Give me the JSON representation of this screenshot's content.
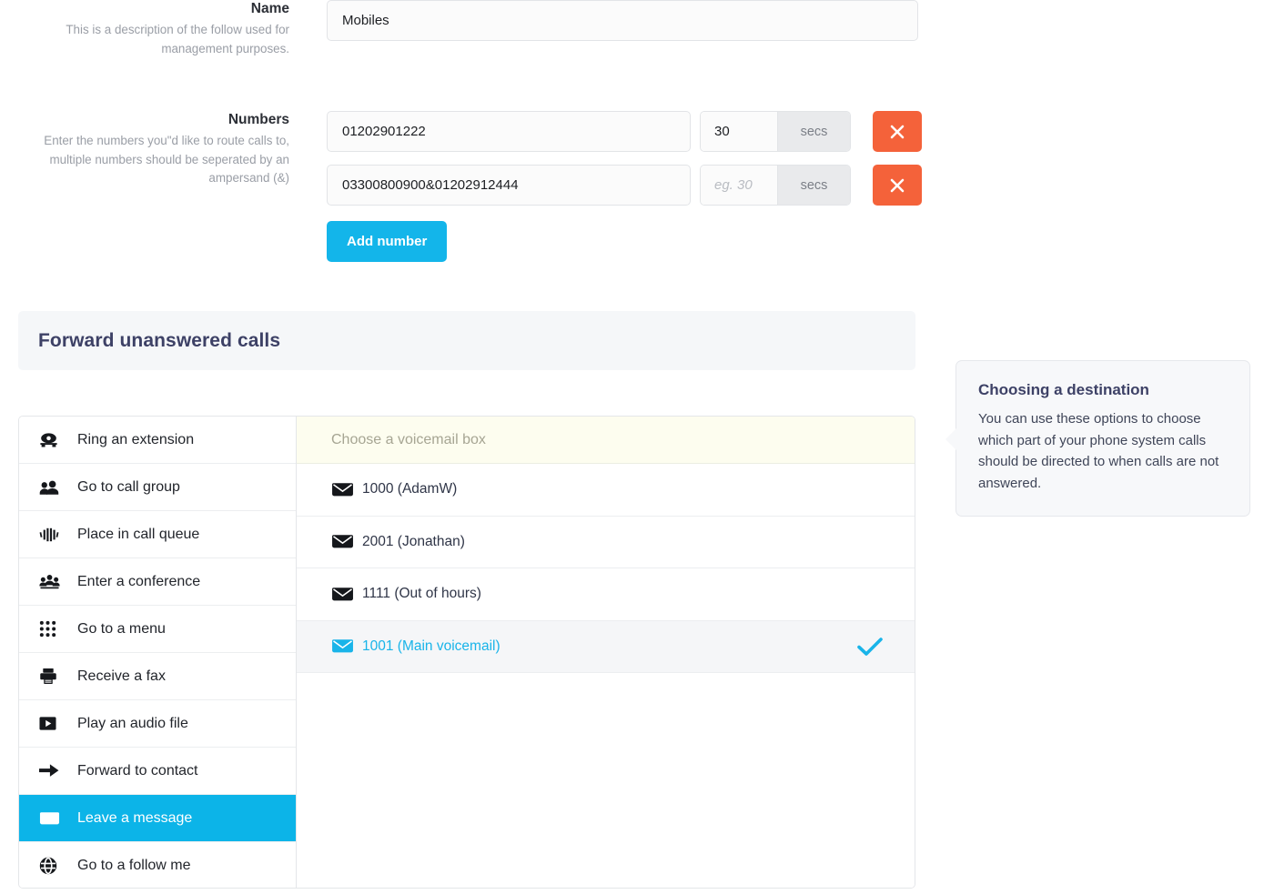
{
  "form": {
    "name_field": {
      "label": "Name",
      "help": "This is a description of the follow used for management purposes.",
      "value": "Mobiles"
    },
    "numbers_field": {
      "label": "Numbers",
      "help": "Enter the numbers you\"d like to route calls to, multiple numbers should be seperated by an ampersand (&)",
      "rows": [
        {
          "number": "01202901222",
          "secs_value": "30",
          "secs_placeholder": "eg. 30",
          "secs_unit": "secs",
          "remove_label": "×"
        },
        {
          "number": "03300800900&01202912444",
          "secs_value": "",
          "secs_placeholder": "eg. 30",
          "secs_unit": "secs",
          "remove_label": "×"
        }
      ],
      "add_button": "Add number"
    }
  },
  "section": {
    "title": "Forward unanswered calls"
  },
  "destinations": [
    {
      "label": "Ring an extension",
      "icon": "telephone-icon",
      "active": false
    },
    {
      "label": "Go to call group",
      "icon": "users-icon",
      "active": false
    },
    {
      "label": "Place in call queue",
      "icon": "signal-bars-icon",
      "active": false
    },
    {
      "label": "Enter a conference",
      "icon": "conference-group-icon",
      "active": false
    },
    {
      "label": "Go to a menu",
      "icon": "keypad-grid-icon",
      "active": false
    },
    {
      "label": "Receive a fax",
      "icon": "fax-printer-icon",
      "active": false
    },
    {
      "label": "Play an audio file",
      "icon": "play-button-icon",
      "active": false
    },
    {
      "label": "Forward to contact",
      "icon": "arrow-right-icon",
      "active": false
    },
    {
      "label": "Leave a message",
      "icon": "envelope-icon",
      "active": true
    },
    {
      "label": "Go to a follow me",
      "icon": "globe-icon",
      "active": false
    }
  ],
  "voicemail": {
    "header": "Choose a voicemail box",
    "items": [
      {
        "label": "1000 (AdamW)",
        "icon": "envelope-icon",
        "selected": false
      },
      {
        "label": "2001 (Jonathan)",
        "icon": "envelope-icon",
        "selected": false
      },
      {
        "label": "1111 (Out of hours)",
        "icon": "envelope-icon",
        "selected": false
      },
      {
        "label": "1001 (Main voicemail)",
        "icon": "envelope-icon",
        "selected": true
      }
    ]
  },
  "tooltip": {
    "title": "Choosing a destination",
    "body": "You can use these options to choose which part of your phone system calls should be directed to when calls are not answered."
  },
  "colors": {
    "accent_cyan": "#0cb4e8",
    "danger_orange": "#f4623a",
    "heading_navy": "#3d4166",
    "panel_gray": "#f5f7f9",
    "vm_header_cream": "#fdfdef"
  }
}
